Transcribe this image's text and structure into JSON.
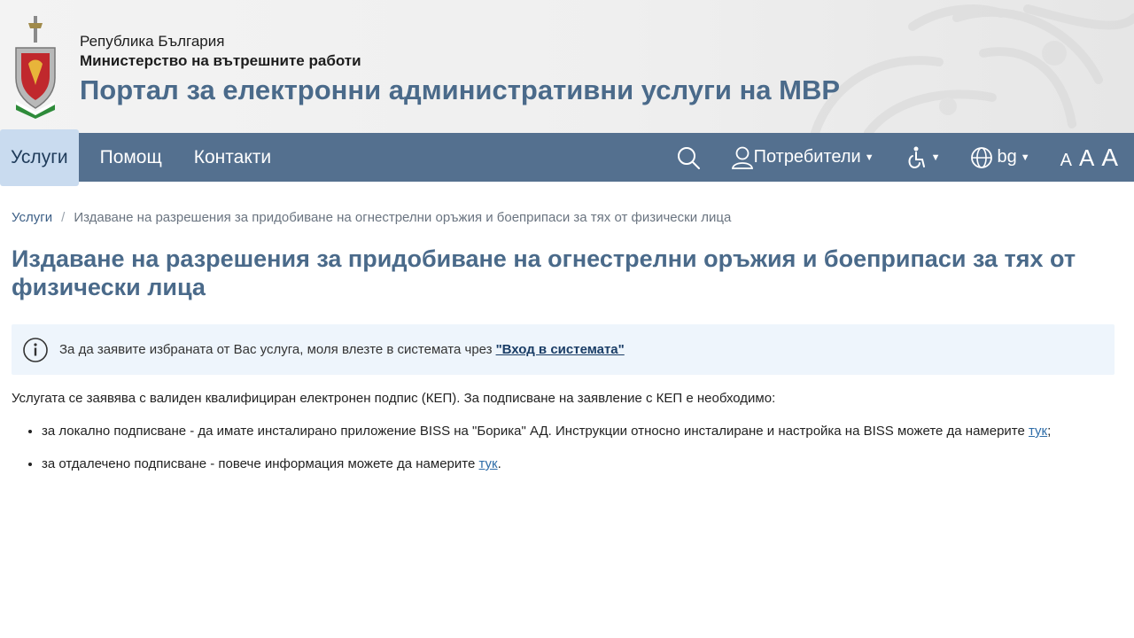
{
  "header": {
    "country": "Република България",
    "ministry": "Министерство на вътрешните работи",
    "portal_title": "Портал за електронни административни услуги на МВР"
  },
  "nav": {
    "items": [
      {
        "label": "Услуги",
        "active": true
      },
      {
        "label": "Помощ",
        "active": false
      },
      {
        "label": "Контакти",
        "active": false
      }
    ],
    "users_label": "Потребители",
    "language_label": "bg",
    "font_controls": [
      "A",
      "A",
      "A"
    ]
  },
  "breadcrumb": {
    "home": "Услуги",
    "separator": "/",
    "current": "Издаване на разрешения за придобиване на огнестрелни оръжия и боеприпаси за тях от физически лица"
  },
  "page": {
    "title": "Издаване на разрешения за придобиване на огнестрелни оръжия и боеприпаси за тях от физически лица",
    "alert_text": "За да заявите избраната от Вас услуга, моля влезте в системата чрез",
    "alert_link": "\"Вход в системата\"",
    "intro": "Услугата се заявява с валиден квалифициран електронен подпис (КЕП). За подписване на заявление с КЕП е необходимо:",
    "bullet1_text": "за локално подписване - да имате инсталирано приложение BISS на \"Борика\" АД. Инструкции относно инсталиране и настройка на BISS можете да намерите",
    "bullet1_link": "тук",
    "bullet1_end": ";",
    "bullet2_text": "за отдалечено подписване - повече информация можете да намерите",
    "bullet2_link": "тук",
    "bullet2_end": "."
  },
  "colors": {
    "nav_bg": "#54708f",
    "nav_active_bg": "#c9dbef",
    "title_color": "#4a6a8a",
    "alert_bg": "#eef5fc",
    "link": "#2f6da8"
  }
}
